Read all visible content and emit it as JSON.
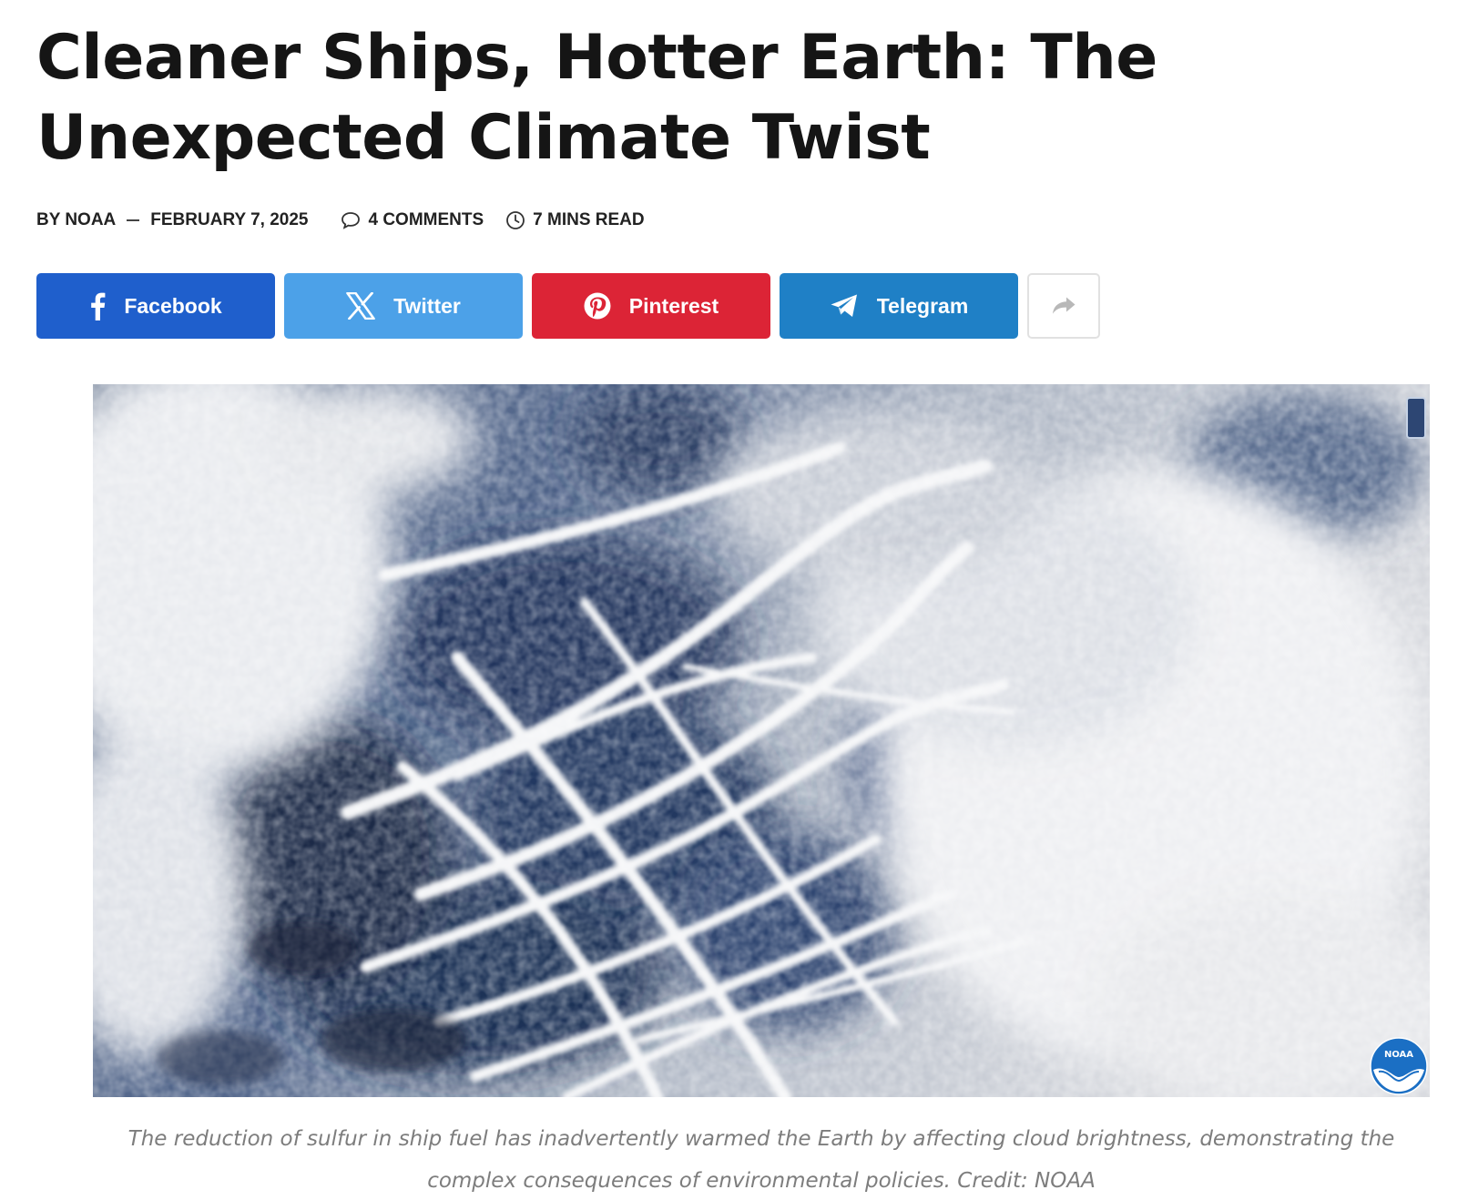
{
  "article": {
    "title": "Cleaner Ships, Hotter Earth: The Unexpected Climate Twist",
    "byline": "BY NOAA",
    "date": "FEBRUARY 7, 2025",
    "comments": "4 COMMENTS",
    "read_time": "7 MINS READ"
  },
  "share": {
    "buttons": [
      {
        "label": "Facebook",
        "icon": "facebook-icon",
        "color": "#1f5fcc"
      },
      {
        "label": "Twitter",
        "icon": "x-icon",
        "color": "#4ca1e8"
      },
      {
        "label": "Pinterest",
        "icon": "pinterest-icon",
        "color": "#dc2436"
      },
      {
        "label": "Telegram",
        "icon": "telegram-icon",
        "color": "#1f80c6"
      }
    ],
    "more_icon": "share-arrow-icon"
  },
  "figure": {
    "caption": "The reduction of sulfur in ship fuel has inadvertently warmed the Earth by affecting cloud brightness, demonstrating the complex consequences of environmental policies. Credit: NOAA",
    "logo_text": "NOAA"
  }
}
